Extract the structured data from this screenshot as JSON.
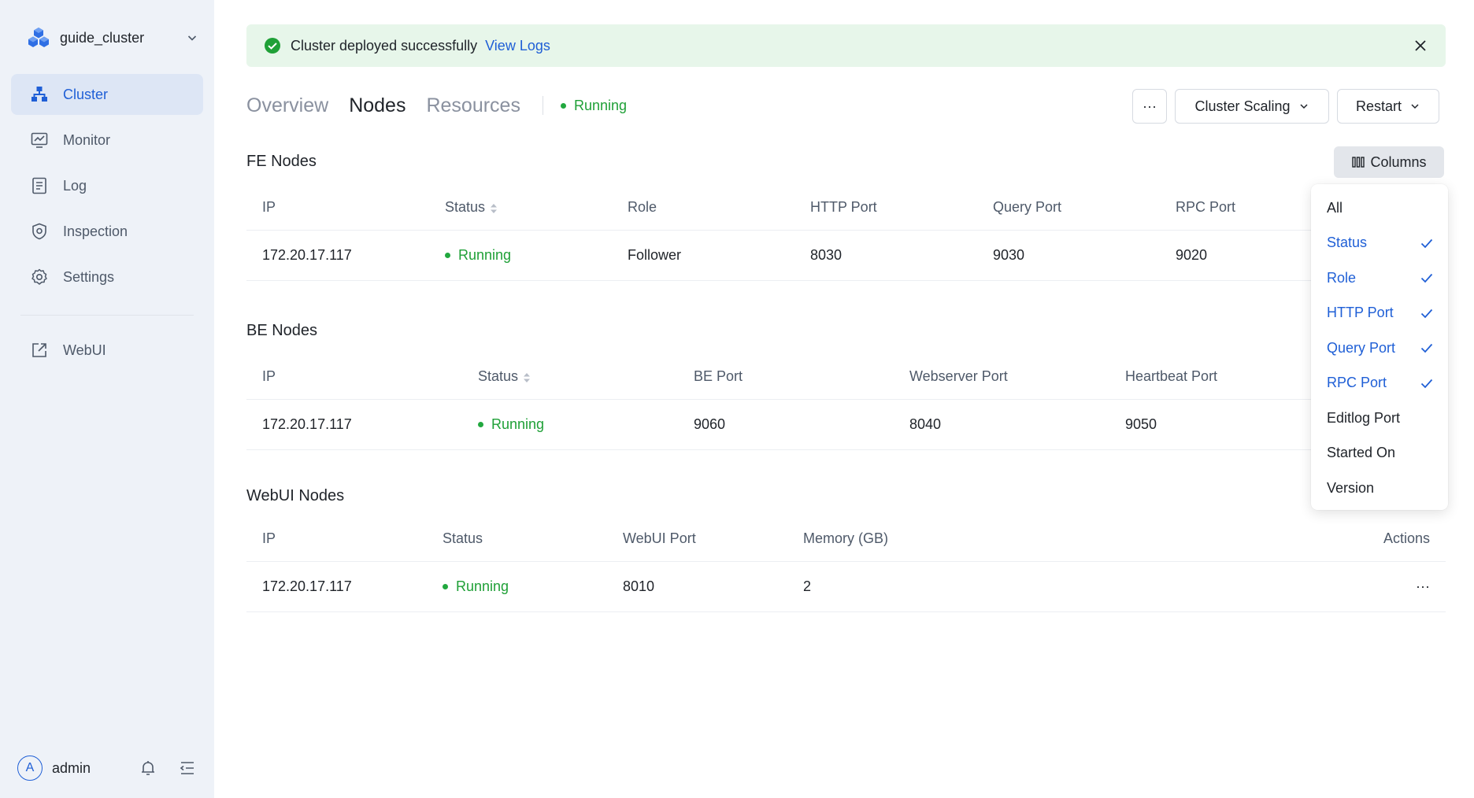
{
  "sidebar": {
    "cluster_name": "guide_cluster",
    "items": [
      {
        "label": "Cluster",
        "icon": "cluster-icon",
        "active": true
      },
      {
        "label": "Monitor",
        "icon": "monitor-icon",
        "active": false
      },
      {
        "label": "Log",
        "icon": "log-icon",
        "active": false
      },
      {
        "label": "Inspection",
        "icon": "shield-icon",
        "active": false
      },
      {
        "label": "Settings",
        "icon": "gear-icon",
        "active": false
      }
    ],
    "webui": {
      "label": "WebUI",
      "icon": "external-link-icon"
    },
    "user": {
      "avatar_letter": "A",
      "name": "admin"
    }
  },
  "alert": {
    "message": "Cluster deployed successfully",
    "link": "View Logs"
  },
  "tabs": [
    "Overview",
    "Nodes",
    "Resources"
  ],
  "active_tab": "Nodes",
  "cluster_status": "Running",
  "toolbar": {
    "more": "···",
    "scaling": "Cluster Scaling",
    "restart": "Restart",
    "columns": "Columns"
  },
  "fe": {
    "title": "FE Nodes",
    "headers": [
      "IP",
      "Status",
      "Role",
      "HTTP Port",
      "Query Port",
      "RPC Port"
    ],
    "rows": [
      {
        "ip": "172.20.17.117",
        "status": "Running",
        "role": "Follower",
        "http_port": "8030",
        "query_port": "9030",
        "rpc_port": "9020"
      }
    ]
  },
  "be": {
    "title": "BE Nodes",
    "headers": [
      "IP",
      "Status",
      "BE Port",
      "Webserver Port",
      "Heartbeat Port"
    ],
    "rows": [
      {
        "ip": "172.20.17.117",
        "status": "Running",
        "be_port": "9060",
        "webserver_port": "8040",
        "heartbeat_port": "9050"
      }
    ]
  },
  "webui": {
    "title": "WebUI Nodes",
    "headers": [
      "IP",
      "Status",
      "WebUI Port",
      "Memory (GB)",
      "Actions"
    ],
    "rows": [
      {
        "ip": "172.20.17.117",
        "status": "Running",
        "webui_port": "8010",
        "memory": "2",
        "action": "···"
      }
    ]
  },
  "columns_menu": [
    {
      "label": "All",
      "checked": false
    },
    {
      "label": "Status",
      "checked": true
    },
    {
      "label": "Role",
      "checked": true
    },
    {
      "label": "HTTP Port",
      "checked": true
    },
    {
      "label": "Query Port",
      "checked": true
    },
    {
      "label": "RPC Port",
      "checked": true
    },
    {
      "label": "Editlog Port",
      "checked": false
    },
    {
      "label": "Started On",
      "checked": false
    },
    {
      "label": "Version",
      "checked": false
    }
  ],
  "colors": {
    "accent": "#1f5fd6",
    "success": "#1fa037",
    "sidebar_bg": "#eef2f8",
    "alert_bg": "#e7f6ea"
  }
}
